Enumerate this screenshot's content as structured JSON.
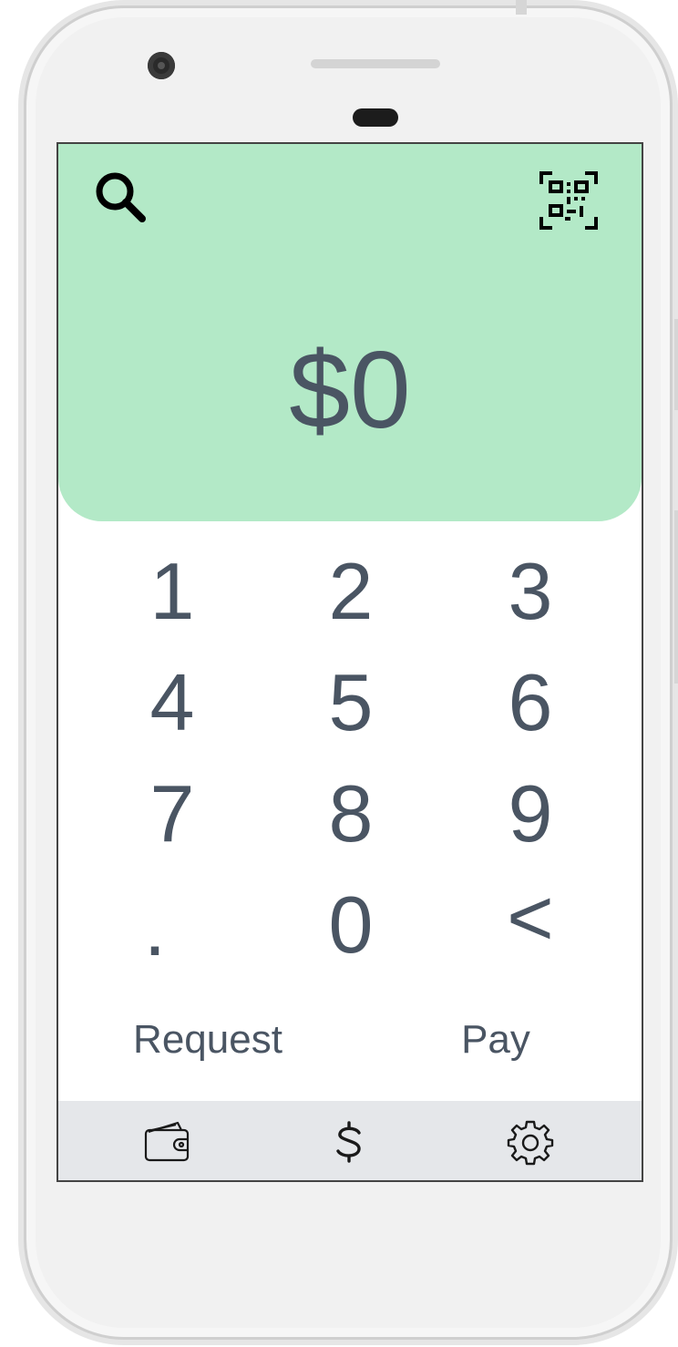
{
  "amount": {
    "display": "$0"
  },
  "header": {
    "background_color": "#b3e9c7",
    "search_icon": "search-icon",
    "scan_icon": "qr-scan-icon"
  },
  "keypad": {
    "keys": [
      {
        "label": "1"
      },
      {
        "label": "2"
      },
      {
        "label": "3"
      },
      {
        "label": "4"
      },
      {
        "label": "5"
      },
      {
        "label": "6"
      },
      {
        "label": "7"
      },
      {
        "label": "8"
      },
      {
        "label": "9"
      },
      {
        "label": "."
      },
      {
        "label": "0"
      },
      {
        "label": "<"
      }
    ]
  },
  "actions": {
    "request_label": "Request",
    "pay_label": "Pay"
  },
  "bottom_nav": {
    "items": [
      {
        "icon": "wallet-icon"
      },
      {
        "icon": "dollar-icon"
      },
      {
        "icon": "gear-icon"
      }
    ],
    "background_color": "#e5e7ea"
  },
  "colors": {
    "text": "#4a5563",
    "accent": "#b3e9c7"
  }
}
